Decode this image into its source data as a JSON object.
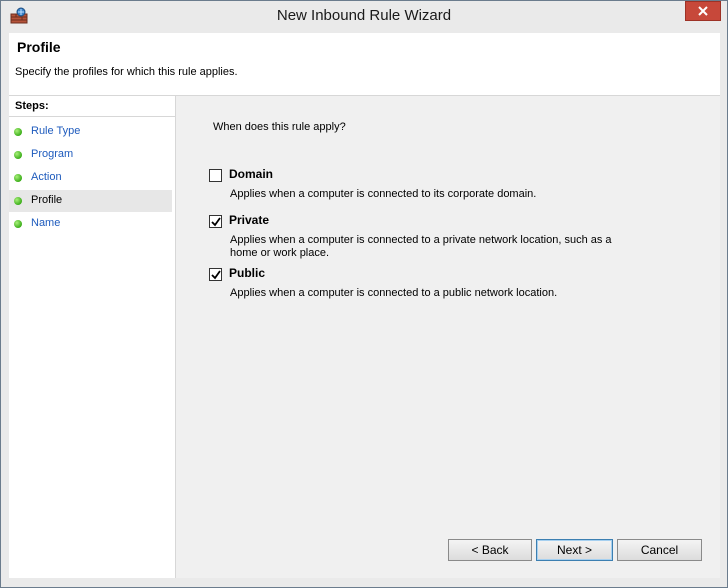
{
  "window": {
    "title": "New Inbound Rule Wizard"
  },
  "header": {
    "title": "Profile",
    "description": "Specify the profiles for which this rule applies."
  },
  "steps": {
    "title": "Steps:",
    "items": [
      {
        "label": "Rule Type"
      },
      {
        "label": "Program"
      },
      {
        "label": "Action"
      },
      {
        "label": "Profile"
      },
      {
        "label": "Name"
      }
    ],
    "current": "Profile"
  },
  "main": {
    "question": "When does this rule apply?",
    "options": [
      {
        "label": "Domain",
        "description": "Applies when a computer is connected to its corporate domain.",
        "checked": false
      },
      {
        "label": "Private",
        "description": "Applies when a computer is connected to a private network location, such as a home or work place.",
        "checked": true
      },
      {
        "label": "Public",
        "description": "Applies when a computer is connected to a public network location.",
        "checked": true
      }
    ]
  },
  "buttons": {
    "back": "< Back",
    "next": "Next >",
    "cancel": "Cancel"
  },
  "colors": {
    "close_button": "#c7483a",
    "step_link": "#1e5bbd",
    "step_dot": "#3cae1a"
  }
}
